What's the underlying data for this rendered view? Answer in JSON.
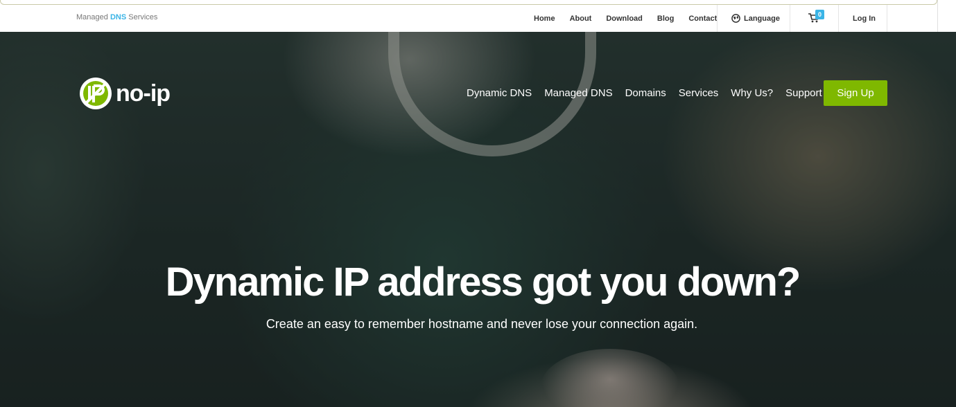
{
  "topbar": {
    "tagline_prefix": "Managed",
    "tagline_dns": "DNS",
    "tagline_suffix": "Services",
    "links": [
      "Home",
      "About",
      "Download",
      "Blog",
      "Contact"
    ],
    "language_label": "Language",
    "cart_count": "0",
    "login_label": "Log In"
  },
  "header": {
    "logo_text": "no-ip",
    "nav": [
      "Dynamic DNS",
      "Managed DNS",
      "Domains",
      "Services",
      "Why Us?",
      "Support"
    ],
    "signup_label": "Sign Up"
  },
  "hero": {
    "headline": "Dynamic IP address got you down?",
    "subline": "Create an easy to remember hostname and never lose your connection again."
  },
  "colors": {
    "accent_green": "#7fb800",
    "accent_blue": "#3ab4e6"
  },
  "icons": {
    "language": "globe-icon",
    "cart": "cart-icon",
    "logo": "noip-logo-icon"
  }
}
